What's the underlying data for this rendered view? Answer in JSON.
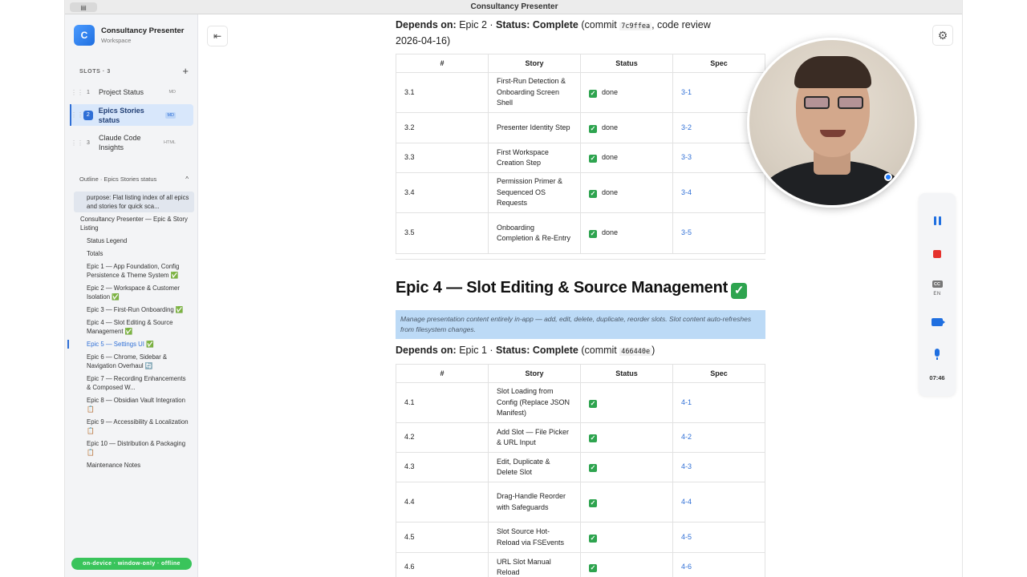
{
  "window": {
    "title": "Consultancy Presenter",
    "toggle_icon": "sidebar-icon"
  },
  "workspace": {
    "avatar_letter": "C",
    "name": "Consultancy Presenter",
    "subtitle": "Workspace"
  },
  "slots": {
    "header": "SLOTS · 3",
    "add_label": "+",
    "items": [
      {
        "num": "1",
        "name": "Project Status",
        "badge": "MD"
      },
      {
        "num": "2",
        "name": "Epics Stories status",
        "badge": "MD"
      },
      {
        "num": "3",
        "name": "Claude Code Insights",
        "badge": "HTML"
      }
    ]
  },
  "outline": {
    "header": "Outline · Epics Stories status",
    "chevron": "^",
    "items": [
      "purpose: Flat listing index of all epics and stories for quick sca...",
      "Consultancy Presenter — Epic & Story Listing",
      "Status Legend",
      "Totals",
      "Epic 1 — App Foundation, Config Persistence & Theme System ✅",
      "Epic 2 — Workspace & Customer Isolation ✅",
      "Epic 3 — First-Run Onboarding ✅",
      "Epic 4 — Slot Editing & Source Management ✅",
      "Epic 5 — Settings UI ✅",
      "Epic 6 — Chrome, Sidebar & Navigation Overhaul 🔄",
      "Epic 7 — Recording Enhancements & Composed W...",
      "Epic 8 — Obsidian Vault Integration 📋",
      "Epic 9 — Accessibility & Localization 📋",
      "Epic 10 — Distribution & Packaging 📋",
      "Maintenance Notes"
    ]
  },
  "footer": {
    "status": "on-device · window-only · offline"
  },
  "epic3": {
    "depends_prefix": "Depends on:",
    "depends_value": "Epic 2",
    "status_label": "Status: Complete",
    "commit_prefix": "(commit",
    "commit_hash": "7c9ffea",
    "commit_suffix": ", code review 2026-04-16)",
    "columns": [
      "#",
      "Story",
      "Status",
      "Spec"
    ],
    "rows": [
      {
        "id": "3.1",
        "story": "First-Run Detection & Onboarding Screen Shell",
        "status": "done",
        "spec": "3-1"
      },
      {
        "id": "3.2",
        "story": "Presenter Identity Step",
        "status": "done",
        "spec": "3-2"
      },
      {
        "id": "3.3",
        "story": "First Workspace Creation Step",
        "status": "done",
        "spec": "3-3"
      },
      {
        "id": "3.4",
        "story": "Permission Primer & Sequenced OS Requests",
        "status": "done",
        "spec": "3-4"
      },
      {
        "id": "3.5",
        "story": "Onboarding Completion & Re-Entry",
        "status": "done",
        "spec": "3-5"
      }
    ]
  },
  "epic4": {
    "heading": "Epic 4 — Slot Editing & Source Management",
    "check": "✓",
    "description": "Manage presentation content entirely in-app — add, edit, delete, duplicate, reorder slots. Slot content auto-refreshes from filesystem changes.",
    "depends_prefix": "Depends on:",
    "depends_value": "Epic 1",
    "status_label": "Status: Complete",
    "commit_prefix": "(commit",
    "commit_hash": "466440e",
    "commit_suffix": ")",
    "columns": [
      "#",
      "Story",
      "Status",
      "Spec"
    ],
    "rows": [
      {
        "id": "4.1",
        "story": "Slot Loading from Config (Replace JSON Manifest)",
        "spec": "4-1"
      },
      {
        "id": "4.2",
        "story": "Add Slot — File Picker & URL Input",
        "spec": "4-2"
      },
      {
        "id": "4.3",
        "story": "Edit, Duplicate & Delete Slot",
        "spec": "4-3"
      },
      {
        "id": "4.4",
        "story": "Drag-Handle Reorder with Safeguards",
        "spec": "4-4"
      },
      {
        "id": "4.5",
        "story": "Slot Source Hot-Reload via FSEvents",
        "spec": "4-5"
      },
      {
        "id": "4.6",
        "story": "URL Slot Manual Reload",
        "spec": "4-6"
      }
    ]
  },
  "recorder": {
    "cc_label": "CC",
    "lang": "EN",
    "timer": "07:46"
  },
  "colors": {
    "accent": "#2f6fd6",
    "done_green": "#2ea44f",
    "stop_red": "#e5322d",
    "offline_green": "#39c45b"
  }
}
